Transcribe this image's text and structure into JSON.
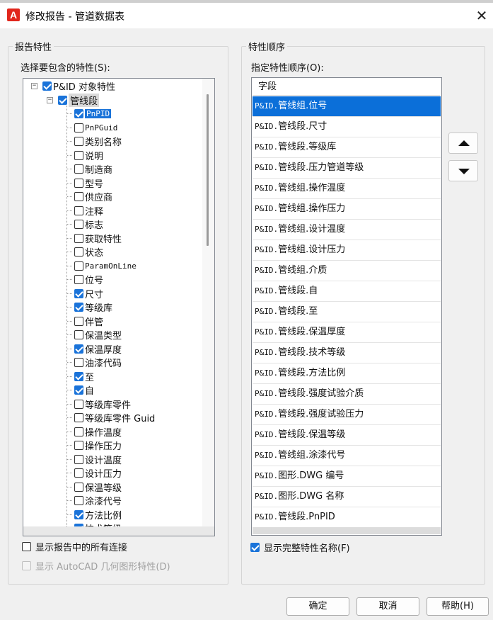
{
  "window": {
    "title": "修改报告 - 管道数据表",
    "close_glyph": "✕",
    "logo_letter": "A"
  },
  "left_group": {
    "title": "报告特性",
    "prompt": "选择要包含的特性(S):",
    "tree": {
      "root": {
        "label": "P&ID 对象特性",
        "checked": true,
        "expander": "⊟"
      },
      "branch": {
        "label": "管线段",
        "checked": true,
        "expander": "⊟"
      },
      "items": [
        {
          "label": "PnPID",
          "checked": true
        },
        {
          "label": "PnPGuid",
          "checked": false
        },
        {
          "label": "类别名称",
          "checked": false
        },
        {
          "label": "说明",
          "checked": false
        },
        {
          "label": "制造商",
          "checked": false
        },
        {
          "label": "型号",
          "checked": false
        },
        {
          "label": "供应商",
          "checked": false
        },
        {
          "label": "注释",
          "checked": false
        },
        {
          "label": "标志",
          "checked": false
        },
        {
          "label": "获取特性",
          "checked": false
        },
        {
          "label": "状态",
          "checked": false
        },
        {
          "label": "ParamOnLine",
          "checked": false
        },
        {
          "label": "位号",
          "checked": false
        },
        {
          "label": "尺寸",
          "checked": true
        },
        {
          "label": "等级库",
          "checked": true
        },
        {
          "label": "伴管",
          "checked": false
        },
        {
          "label": "保温类型",
          "checked": false
        },
        {
          "label": "保温厚度",
          "checked": true
        },
        {
          "label": "油漆代码",
          "checked": false
        },
        {
          "label": "至",
          "checked": true
        },
        {
          "label": "自",
          "checked": true
        },
        {
          "label": "等级库零件",
          "checked": false
        },
        {
          "label": "等级库零件 Guid",
          "checked": false
        },
        {
          "label": "操作温度",
          "checked": false
        },
        {
          "label": "操作压力",
          "checked": false
        },
        {
          "label": "设计温度",
          "checked": false
        },
        {
          "label": "设计压力",
          "checked": false
        },
        {
          "label": "保温等级",
          "checked": false
        },
        {
          "label": "涂漆代号",
          "checked": false
        },
        {
          "label": "方法比例",
          "checked": true
        },
        {
          "label": "技术等级",
          "checked": true
        }
      ]
    },
    "show_all_connections": {
      "label": "显示报告中的所有连接",
      "checked": false
    },
    "show_autocad_props": {
      "label": "显示 AutoCAD 几何图形特性(D)",
      "checked": false,
      "disabled": true
    }
  },
  "right_group": {
    "title": "特性顺序",
    "prompt": "指定特性顺序(O):",
    "list_header": "字段",
    "rows": [
      {
        "prefix": "P&ID.",
        "text": "管线组.位号",
        "selected": true
      },
      {
        "prefix": "P&ID.",
        "text": "管线段.尺寸",
        "selected": false
      },
      {
        "prefix": "P&ID.",
        "text": "管线段.等级库",
        "selected": false
      },
      {
        "prefix": "P&ID.",
        "text": "管线段.压力管道等级",
        "selected": false
      },
      {
        "prefix": "P&ID.",
        "text": "管线组.操作温度",
        "selected": false
      },
      {
        "prefix": "P&ID.",
        "text": "管线组.操作压力",
        "selected": false
      },
      {
        "prefix": "P&ID.",
        "text": "管线组.设计温度",
        "selected": false
      },
      {
        "prefix": "P&ID.",
        "text": "管线组.设计压力",
        "selected": false
      },
      {
        "prefix": "P&ID.",
        "text": "管线组.介质",
        "selected": false
      },
      {
        "prefix": "P&ID.",
        "text": "管线段.自",
        "selected": false
      },
      {
        "prefix": "P&ID.",
        "text": "管线段.至",
        "selected": false
      },
      {
        "prefix": "P&ID.",
        "text": "管线段.保温厚度",
        "selected": false
      },
      {
        "prefix": "P&ID.",
        "text": "管线段.技术等级",
        "selected": false
      },
      {
        "prefix": "P&ID.",
        "text": "管线段.方法比例",
        "selected": false
      },
      {
        "prefix": "P&ID.",
        "text": "管线段.强度试验介质",
        "selected": false
      },
      {
        "prefix": "P&ID.",
        "text": "管线段.强度试验压力",
        "selected": false
      },
      {
        "prefix": "P&ID.",
        "text": "管线段.保温等级",
        "selected": false
      },
      {
        "prefix": "P&ID.",
        "text": "管线组.涂漆代号",
        "selected": false
      },
      {
        "prefix": "P&ID.",
        "text": "图形.DWG 编号",
        "selected": false
      },
      {
        "prefix": "P&ID.",
        "text": "图形.DWG 名称",
        "selected": false
      },
      {
        "prefix": "P&ID.",
        "text": "管线段.PnPID",
        "selected": false
      }
    ],
    "show_full_names": {
      "label": "显示完整特性名称(F)",
      "checked": true
    }
  },
  "buttons": {
    "ok": "确定",
    "cancel": "取消",
    "help": "帮助(H)"
  },
  "colors": {
    "accent": "#1a73d9",
    "selection": "#0b6fd9",
    "dialog_bg": "#f0f0f0",
    "logo_red": "#e1261c"
  }
}
